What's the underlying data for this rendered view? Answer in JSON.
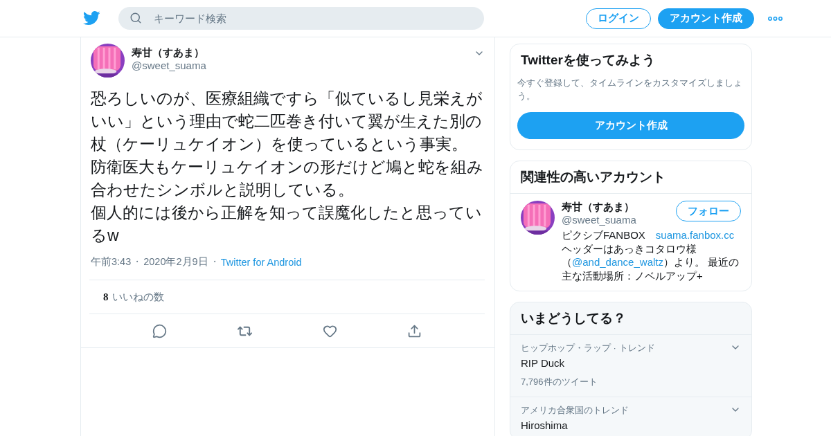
{
  "header": {
    "search": {
      "placeholder": "キーワード検索"
    },
    "login": "ログイン",
    "signup": "アカウント作成"
  },
  "tweet": {
    "name": "寿甘（すあま）",
    "handle": "@sweet_suama",
    "paragraphs": [
      "恐ろしいのが、医療組織ですら「似ているし見栄えがいい」という理由で蛇二匹巻き付いて翼が生えた別の杖（ケーリュケイオン）を使っているという事実。",
      "防衛医大もケーリュケイオンの形だけど鳩と蛇を組み合わせたシンボルと説明している。",
      "個人的には後から正解を知って誤魔化したと思っているw"
    ],
    "meta": [
      {
        "kind": "text",
        "text": "午前3:43"
      },
      {
        "kind": "dot",
        "text": "・"
      },
      {
        "kind": "text",
        "text": "2020年2月9日"
      },
      {
        "kind": "dot",
        "text": "・"
      },
      {
        "kind": "link",
        "text": "Twitter for Android"
      }
    ],
    "likes_count": "8",
    "likes_label": "いいねの数"
  },
  "signup_card": {
    "title": "Twitterを使ってみよう",
    "text": "今すぐ登録して、タイムラインをカスタマイズしましょう。",
    "button": "アカウント作成"
  },
  "related": {
    "title": "関連性の高いアカウント",
    "accounts": [
      {
        "name": "寿甘（すあま）",
        "handle": "@sweet_suama",
        "follow": "フォロー",
        "bio": [
          {
            "kind": "text",
            "text": "ピクシブFANBOX　"
          },
          {
            "kind": "link",
            "text": "suama.fanbox.cc"
          },
          {
            "kind": "text",
            "text": " ヘッダーはあっきコタロウ様（"
          },
          {
            "kind": "link",
            "text": "@and_dance_waltz"
          },
          {
            "kind": "text",
            "text": "）より。 最近の主な活動場所：ノベルアップ+"
          }
        ]
      }
    ]
  },
  "trends": {
    "title": "いまどうしてる？",
    "items": [
      {
        "context": "ヒップホップ・ラップ · トレンド",
        "name": "RIP Duck",
        "count": "7,796件のツイート"
      },
      {
        "context": "アメリカ合衆国のトレンド",
        "name": "Hiroshima"
      }
    ]
  }
}
